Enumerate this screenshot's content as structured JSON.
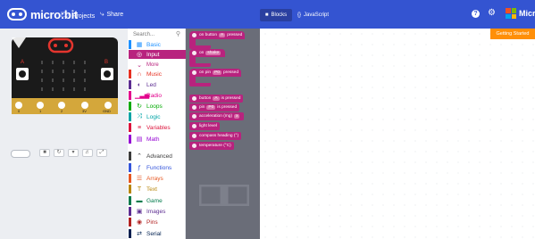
{
  "header": {
    "logo_text": "micro:bit",
    "projects_label": "Projects",
    "share_label": "Share",
    "blocks_label": "Blocks",
    "javascript_label": "JavaScript",
    "help_glyph": "?",
    "brand_label": "Microsoft",
    "colors": {
      "bar": "#3454D1",
      "active_toggle": "#2A3FA0"
    }
  },
  "toolbox": {
    "search_placeholder": "Search...",
    "categories": [
      {
        "label": "Basic",
        "color": "#1E90FF",
        "icon": "grid-icon"
      },
      {
        "label": "Input",
        "color": "#B8237E",
        "icon": "target-icon",
        "selected": true
      },
      {
        "label": "More",
        "color": "#B8237E",
        "icon": "chevron-down-icon"
      },
      {
        "label": "Music",
        "color": "#E63022",
        "icon": "headphones-icon"
      },
      {
        "label": "Led",
        "color": "#5C2D91",
        "icon": "toggle-icon"
      },
      {
        "label": "Radio",
        "color": "#E3008C",
        "icon": "signal-icon"
      },
      {
        "label": "Loops",
        "color": "#00AA00",
        "icon": "refresh-icon"
      },
      {
        "label": "Logic",
        "color": "#00A4A6",
        "icon": "shuffle-icon"
      },
      {
        "label": "Variables",
        "color": "#DC143C",
        "icon": "list-icon"
      },
      {
        "label": "Math",
        "color": "#9400D3",
        "icon": "calculator-icon"
      },
      {
        "label": "Advanced",
        "color": "#3C3C3C",
        "icon": "chevron-up-icon"
      },
      {
        "label": "Functions",
        "color": "#3455DB",
        "icon": "function-icon"
      },
      {
        "label": "Arrays",
        "color": "#E65722",
        "icon": "array-icon"
      },
      {
        "label": "Text",
        "color": "#B8860B",
        "icon": "text-icon"
      },
      {
        "label": "Game",
        "color": "#007A4B",
        "icon": "gamepad-icon"
      },
      {
        "label": "Images",
        "color": "#5C2D91",
        "icon": "image-icon"
      },
      {
        "label": "Pins",
        "color": "#B22222",
        "icon": "pin-icon"
      },
      {
        "label": "Serial",
        "color": "#002050",
        "icon": "serial-icon"
      }
    ]
  },
  "flyout": {
    "blocks": [
      {
        "prefix": "on button",
        "field": "A",
        "suffix": "pressed",
        "hat": true
      },
      {
        "prefix": "on",
        "field": "shake",
        "suffix": "",
        "hat": true
      },
      {
        "prefix": "on pin",
        "field": "P0",
        "suffix": "pressed",
        "hat": true
      },
      {
        "prefix": "button",
        "field": "A",
        "suffix": "is pressed",
        "hat": false
      },
      {
        "prefix": "pin",
        "field": "P0",
        "suffix": "is pressed",
        "hat": false
      },
      {
        "prefix": "acceleration (mg)",
        "field": "x",
        "suffix": "",
        "hat": false
      },
      {
        "prefix": "light level",
        "field": "",
        "suffix": "",
        "hat": false
      },
      {
        "prefix": "compass heading (°)",
        "field": "",
        "suffix": "",
        "hat": false
      },
      {
        "prefix": "temperature (°C)",
        "field": "",
        "suffix": "",
        "hat": false
      }
    ],
    "color": "#B8237E"
  },
  "workspace": {
    "getting_started_label": "Getting Started",
    "getting_started_color": "#FF8F08"
  },
  "simulator": {
    "board_color": "#1a1a1a",
    "led_on_color": "#e4352e",
    "pin_labels": [
      "0",
      "1",
      "2",
      "3V",
      "GND"
    ],
    "button_labels": [
      "A",
      "B"
    ],
    "controls": [
      "stop-icon",
      "restart-icon",
      "slowmo-icon",
      "audio-icon",
      "fullscreen-icon"
    ]
  }
}
